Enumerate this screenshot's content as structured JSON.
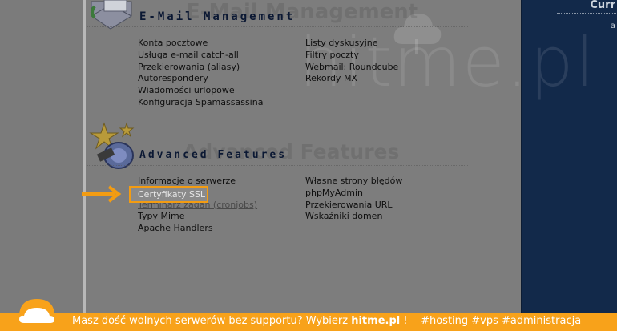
{
  "right_panel": {
    "label": "Curr",
    "small": "a"
  },
  "watermark": {
    "text": "hitme.pl"
  },
  "email_section": {
    "title": "E-Mail Management",
    "ghost": "E-Mail Management",
    "col1": [
      "Konta pocztowe",
      "Usługa e-mail catch-all",
      "Przekierowania (aliasy)",
      "Autorespondery",
      "Wiadomości urlopowe",
      "Konfiguracja Spamassassina"
    ],
    "col2": [
      "Listy dyskusyjne",
      "Filtry poczty",
      "Webmail: Roundcube",
      "Rekordy MX"
    ]
  },
  "advanced_section": {
    "title": "Advanced Features",
    "ghost": "Advanced Features",
    "col1": [
      "Informacje o serwerze",
      "Certyfikaty SSL",
      "Terminarz zadań (cronjobs)",
      "Typy Mime",
      "Apache Handlers"
    ],
    "col2": [
      "Własne strony błędów",
      "phpMyAdmin",
      "Przekierowania URL",
      "Wskaźniki domen"
    ]
  },
  "footer": {
    "text_before": "Masz dość wolnych serwerów bez supportu? Wybierz ",
    "brand": "hitme.pl",
    "text_after": " !",
    "tags": "#hosting #vps #administracja"
  },
  "colors": {
    "accent": "#f8a21a",
    "panel": "#12294a"
  }
}
